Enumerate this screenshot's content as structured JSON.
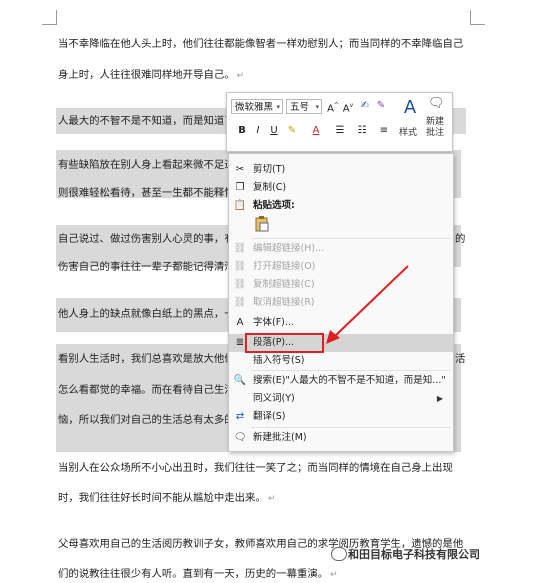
{
  "document": {
    "lines": [
      "当不幸降临在他人头上时，他们往往都能像智者一样劝慰别人；而当同样的不幸降临自己",
      "身上时，人往往很难同样地开导自己。",
      "人最大的不智不是不知道，而是知道了",
      "有些缺陷放在别人身上看起来微不足道",
      "则很难轻松看待，甚至一生都不能释怀",
      "自己说过、做过伤害别人心灵的事，有",
      "伤害自己的事往往一辈子都能记得清清",
      "他人身上的缺点就像白纸上的黑点，一",
      "看别人生活时，我们总喜欢是放大他们",
      "怎么看都觉的幸福。而在看待自己生活",
      "恼，所以我们对自己的生活总有太多的",
      "当别人在公众场所不小心出丑时，我们往往一笑了之；而当同样的情境在自己身上出现",
      "时，我们往往好长时间不能从尴尬中走出来。",
      "父母喜欢用自己的生活阅历教训子女，教师喜欢用自己的求学阅历教育学生，遗憾的是他",
      "们的说教往往很少有人听。直到有一天，历史的一幕重演。"
    ],
    "right_fragments": [
      "的",
      "活"
    ]
  },
  "mini_toolbar": {
    "font": "微软雅黑",
    "size": "五号",
    "styles_label": "样式",
    "new_comment_label": "新建\n批注"
  },
  "context_menu": {
    "items": [
      {
        "label": "剪切(T)",
        "icon": "scissors-icon"
      },
      {
        "label": "复制(C)",
        "icon": "copy-icon"
      },
      {
        "label": "粘贴选项:",
        "icon": "paste-icon"
      },
      {
        "label": "编辑超链接(H)...",
        "icon": "link-icon"
      },
      {
        "label": "打开超链接(O)",
        "icon": "link-icon"
      },
      {
        "label": "复制超链接(C)",
        "icon": "link-icon"
      },
      {
        "label": "取消超链接(R)",
        "icon": "link-icon"
      },
      {
        "label": "字体(F)...",
        "icon": "font-icon"
      },
      {
        "label": "段落(P)...",
        "icon": "paragraph-icon"
      },
      {
        "label": "插入符号(S)",
        "icon": "symbol-icon"
      },
      {
        "label": "搜索(E)\"人最大的不智不是不知道，而是知...\"",
        "icon": "search-icon"
      },
      {
        "label": "同义词(Y)",
        "icon": "thesaurus-icon"
      },
      {
        "label": "翻译(S)",
        "icon": "translate-icon"
      },
      {
        "label": "新建批注(M)",
        "icon": "comment-icon"
      }
    ]
  },
  "watermark": "和田目标电子科技有限公司",
  "colors": {
    "highlight": "#e02020",
    "selection": "#d9d9d9"
  }
}
